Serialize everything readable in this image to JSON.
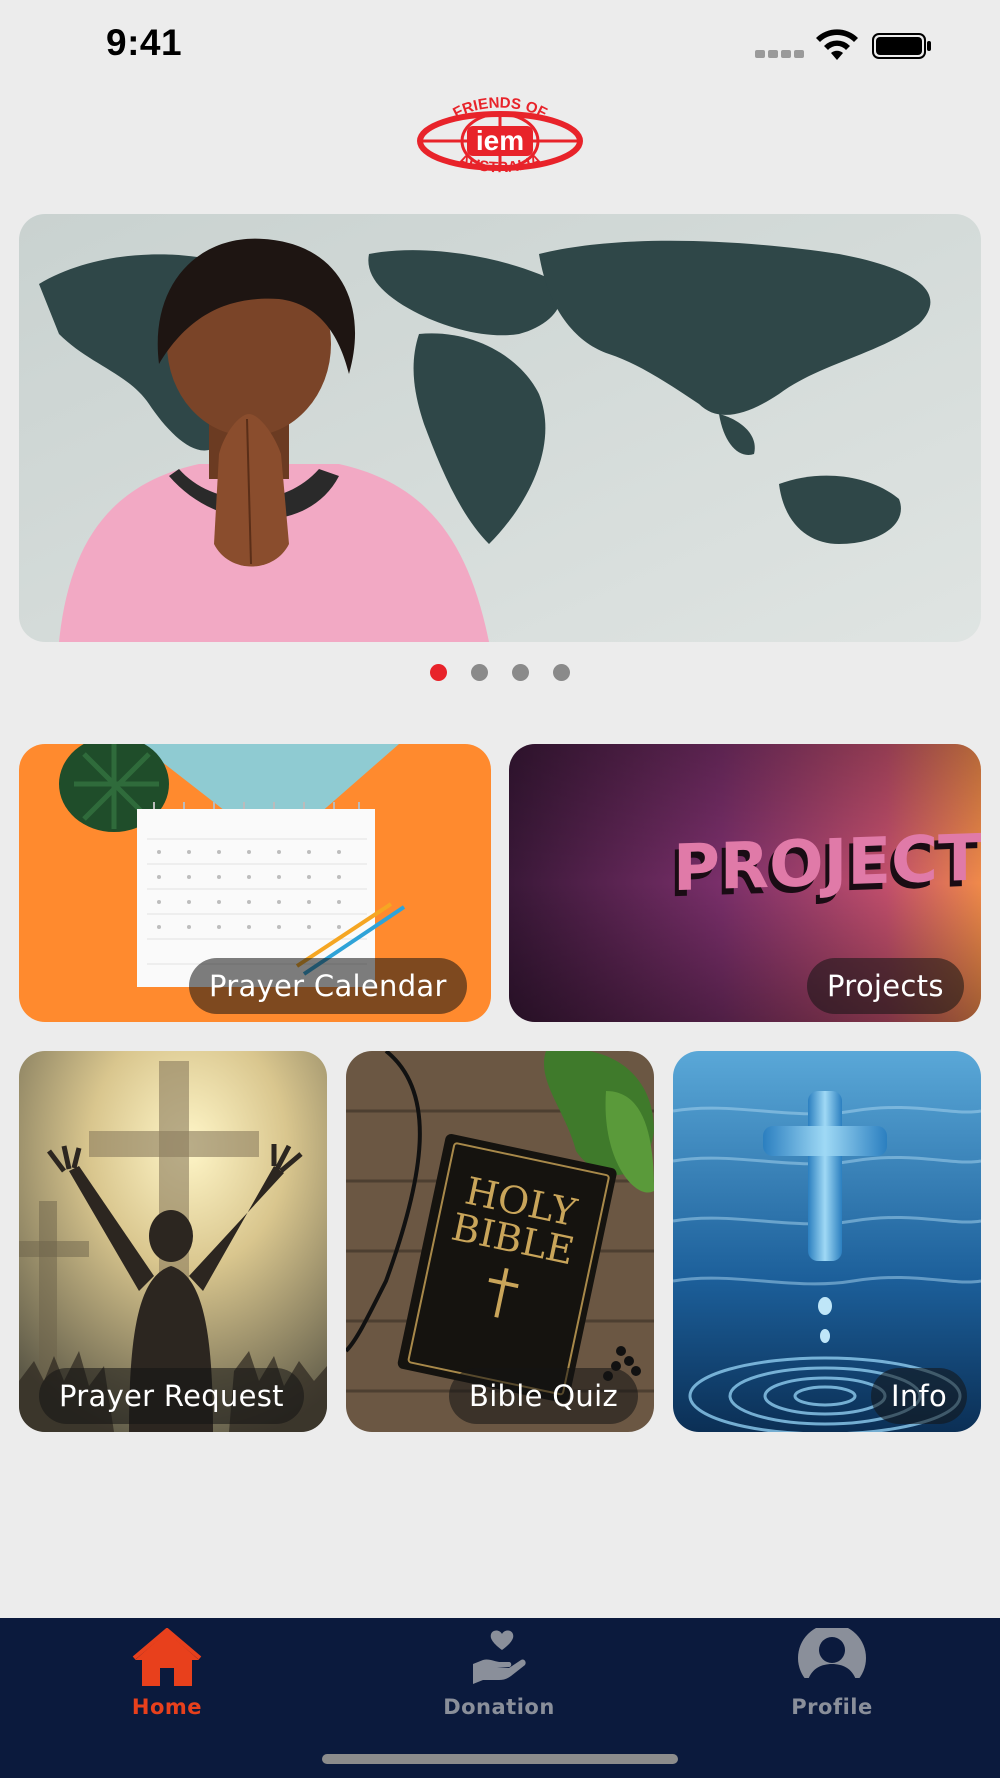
{
  "status_bar": {
    "time": "9:41"
  },
  "logo": {
    "top_text": "FRIENDS OF",
    "center_text": "iem",
    "bottom_text": "AUSTRALIA",
    "color": "#e8232a"
  },
  "carousel": {
    "total_slides": 4,
    "active_index": 0,
    "active_color": "#e8232a",
    "inactive_color": "#8a8a8a"
  },
  "tiles": [
    {
      "label": "Prayer Calendar"
    },
    {
      "label": "Projects",
      "image_text": "PROJECTS"
    },
    {
      "label": "Prayer Request"
    },
    {
      "label": "Bible Quiz",
      "image_text_line1": "HOLY",
      "image_text_line2": "BIBLE"
    },
    {
      "label": "Info"
    }
  ],
  "bottom_nav": {
    "background": "#0b1a3d",
    "active_color": "#e8401c",
    "inactive_color": "#8a8f9a",
    "items": [
      {
        "label": "Home",
        "icon": "home-icon",
        "active": true
      },
      {
        "label": "Donation",
        "icon": "donation-icon",
        "active": false
      },
      {
        "label": "Profile",
        "icon": "profile-icon",
        "active": false
      }
    ]
  }
}
